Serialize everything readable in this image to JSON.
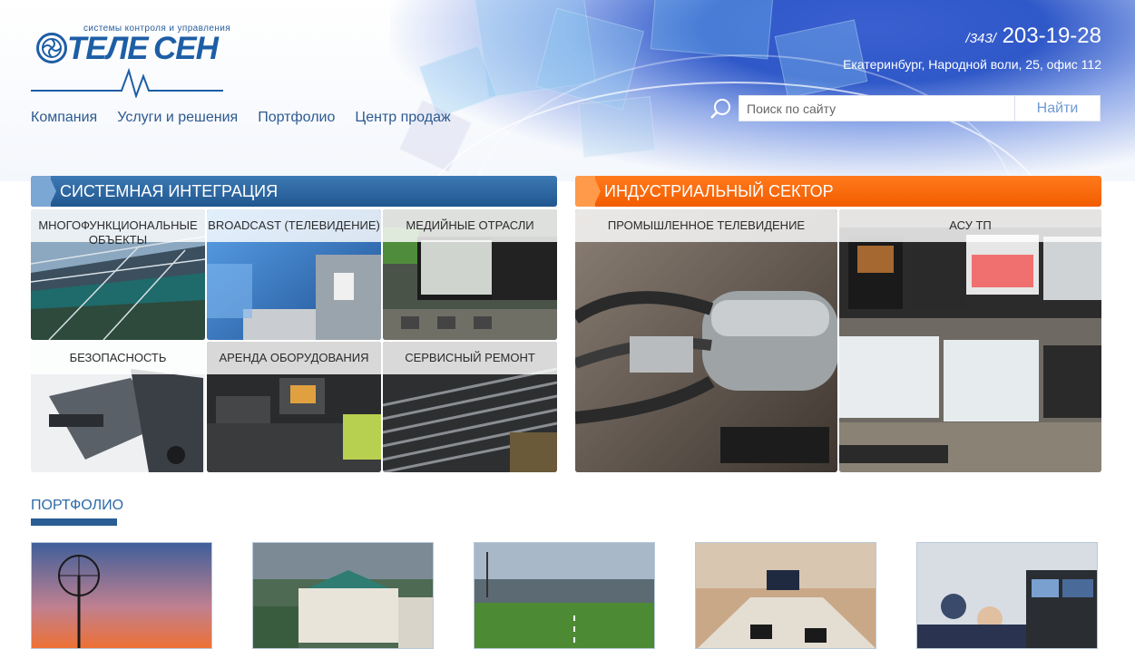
{
  "logo": {
    "tagline": "системы контроля    и управления",
    "word1": "ТЕЛЕ",
    "word2": "СЕН"
  },
  "contacts": {
    "phone_code": "/343/",
    "phone_number": "203-19-28",
    "address": "Екатеринбург, Народной воли, 25, офис 112"
  },
  "nav": [
    {
      "label": "Компания"
    },
    {
      "label": "Услуги и решения"
    },
    {
      "label": "Портфолио"
    },
    {
      "label": "Центр продаж"
    }
  ],
  "search": {
    "placeholder": "Поиск по сайту",
    "button": "Найти"
  },
  "sections": {
    "integration": {
      "title": "СИСТЕМНАЯ ИНТЕГРАЦИЯ",
      "tiles": [
        {
          "label": "МНОГОФУНКЦИОНАЛЬНЫЕ ОБЪЕКТЫ"
        },
        {
          "label": "BROADCAST (ТЕЛЕВИДЕНИЕ)"
        },
        {
          "label": "МЕДИЙНЫЕ ОТРАСЛИ"
        },
        {
          "label": "БЕЗОПАСНОСТЬ"
        },
        {
          "label": "АРЕНДА ОБОРУДОВАНИЯ"
        },
        {
          "label": "СЕРВИСНЫЙ РЕМОНТ"
        }
      ]
    },
    "industrial": {
      "title": "ИНДУСТРИАЛЬНЫЙ СЕКТОР",
      "tiles": [
        {
          "label": "ПРОМЫШЛЕННОЕ ТЕЛЕВИДЕНИЕ"
        },
        {
          "label": "АСУ ТП"
        }
      ]
    }
  },
  "portfolio": {
    "title": "ПОРТФОЛИО"
  },
  "colors": {
    "brand_blue": "#21578f",
    "industrial_orange": "#f25c00",
    "link_blue": "#2d5a91"
  }
}
